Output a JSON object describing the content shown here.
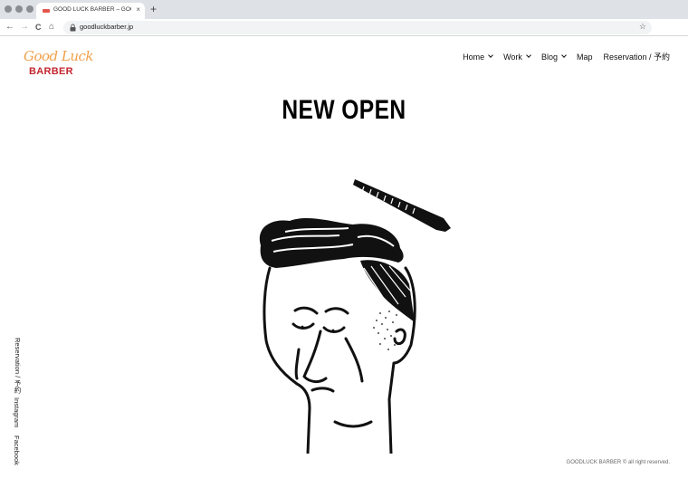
{
  "browser": {
    "tab_title": "GOOD LUCK BARBER – GOOD",
    "tab_close": "×",
    "new_tab": "+",
    "url": "goodluckbarber.jp",
    "back": "←",
    "forward": "→",
    "reload": "C",
    "home": "⌂",
    "bookmark": "☆"
  },
  "logo": {
    "script": "Good Luck",
    "word": "BARBER",
    "colors": {
      "script": "#f0a04b",
      "word": "#c4262e"
    }
  },
  "nav": {
    "items": [
      {
        "label": "Home",
        "dropdown": true
      },
      {
        "label": "Work",
        "dropdown": true
      },
      {
        "label": "Blog",
        "dropdown": true
      },
      {
        "label": "Map",
        "dropdown": false
      },
      {
        "label": "Reservation / 予約",
        "dropdown": false
      }
    ]
  },
  "hero": {
    "headline": "NEW OPEN"
  },
  "side_links": {
    "reservation": "Reservation / 予約",
    "instagram": "Instagram",
    "facebook": "Facebook"
  },
  "footer": {
    "copyright": "GOODLUCK BARBER © all right reserved."
  }
}
